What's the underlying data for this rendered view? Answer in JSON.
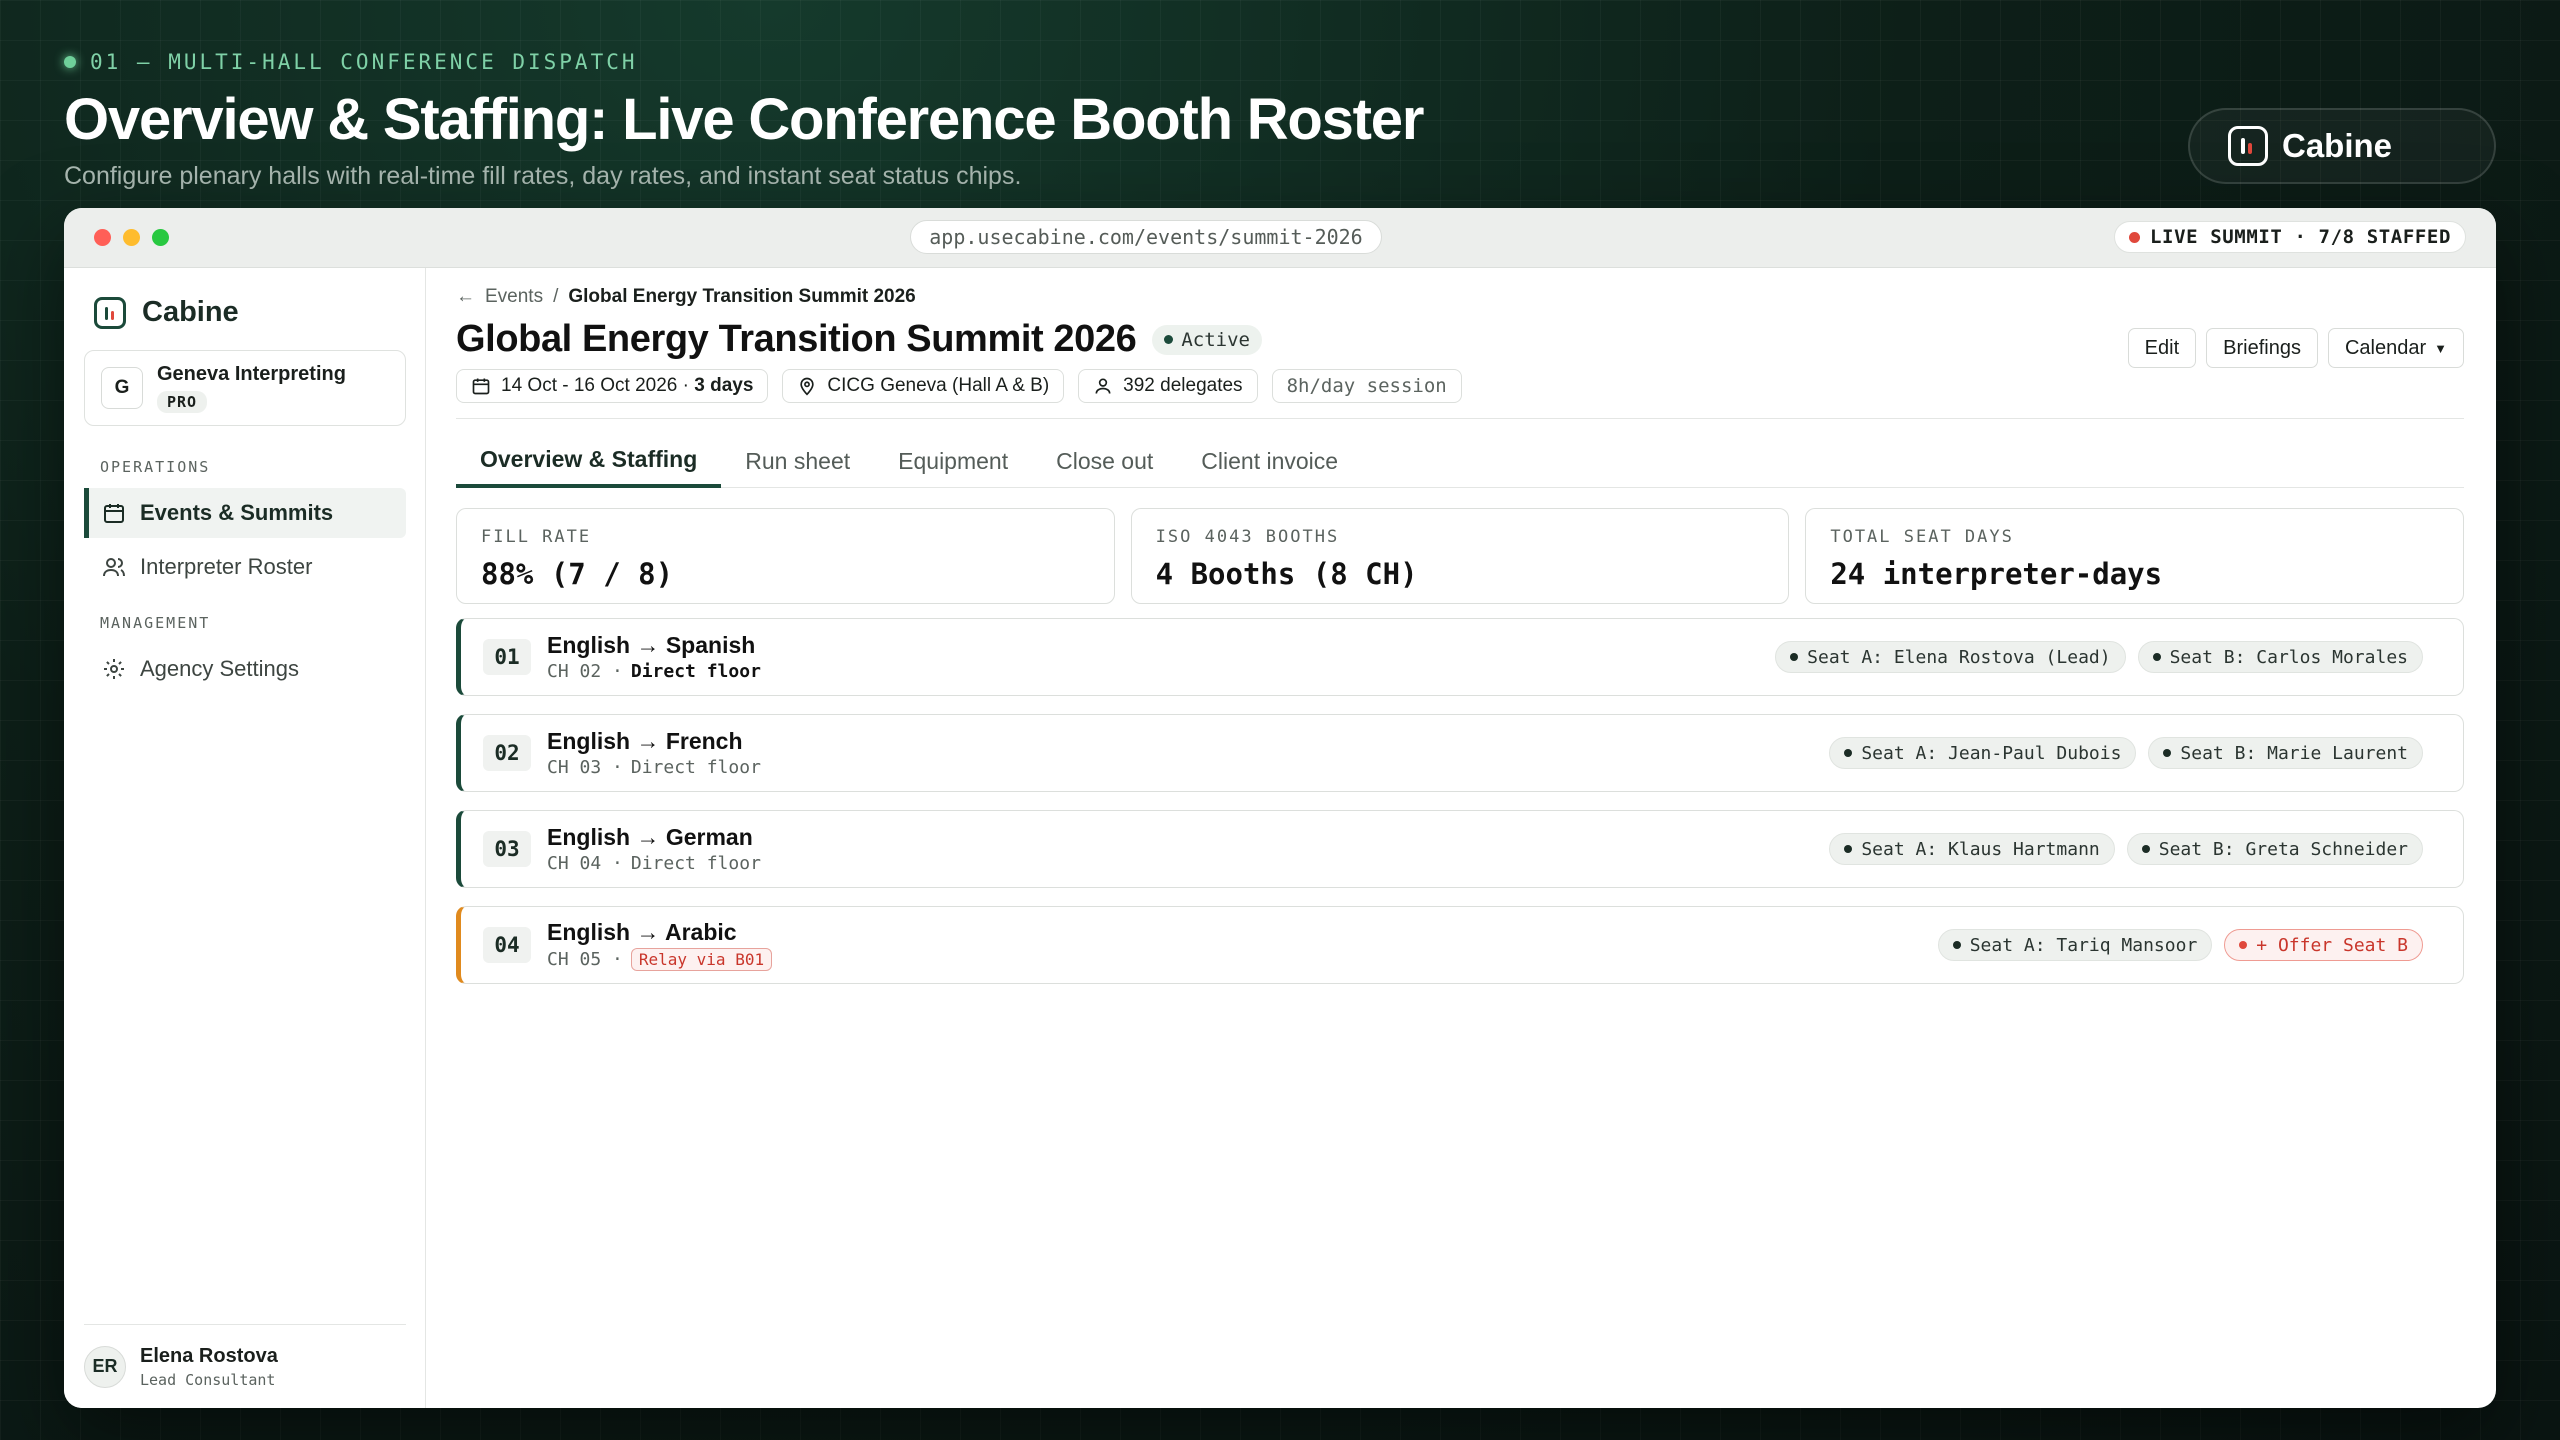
{
  "hero": {
    "kicker": "01 — MULTI-HALL CONFERENCE DISPATCH",
    "title": "Overview & Staffing: Live Conference Booth Roster",
    "subtitle": "Configure plenary halls with real-time fill rates, day rates, and instant seat status chips.",
    "brand": "Cabine"
  },
  "browser": {
    "url": "app.usecabine.com/events/summit-2026",
    "live_badge": "LIVE SUMMIT · 7/8 STAFFED"
  },
  "sidebar": {
    "brand": "Cabine",
    "org": {
      "initial": "G",
      "name": "Geneva Interpreting",
      "plan": "PRO"
    },
    "operations_label": "OPERATIONS",
    "operations": [
      {
        "label": "Events & Summits",
        "icon": "calendar-icon"
      },
      {
        "label": "Interpreter Roster",
        "icon": "users-icon"
      }
    ],
    "management_label": "MANAGEMENT",
    "management": [
      {
        "label": "Agency Settings",
        "icon": "gear-icon"
      }
    ],
    "user": {
      "initials": "ER",
      "name": "Elena Rostova",
      "role": "Lead Consultant"
    }
  },
  "main": {
    "breadcrumb": {
      "parent": "Events",
      "separator": "/",
      "current": "Global Energy Transition Summit 2026"
    },
    "title": "Global Energy Transition Summit 2026",
    "status": "Active",
    "meta": {
      "dates": "14 Oct - 16 Oct 2026 · ",
      "duration": "3 days",
      "venue": "CICG Geneva (Hall A & B)",
      "delegates": "392 delegates",
      "session": "8h/day session"
    },
    "actions": {
      "edit": "Edit",
      "briefings": "Briefings",
      "calendar": "Calendar"
    },
    "tabs": [
      "Overview & Staffing",
      "Run sheet",
      "Equipment",
      "Close out",
      "Client invoice"
    ],
    "stats": [
      {
        "label": "FILL RATE",
        "value": "88% (7 / 8)"
      },
      {
        "label": "ISO 4043 BOOTHS",
        "value": "4 Booths (8 CH)"
      },
      {
        "label": "TOTAL SEAT DAYS",
        "value": "24 interpreter-days"
      }
    ],
    "booths": [
      {
        "num": "01",
        "lang": "English → Spanish",
        "channel": "CH 02 ·",
        "floor": "Direct floor",
        "seat_a": "Seat A: Elena Rostova (Lead)",
        "seat_b": "Seat B: Carlos Morales"
      },
      {
        "num": "02",
        "lang": "English → French",
        "channel": "CH 03 ·",
        "floor": "Direct floor",
        "seat_a": "Seat A: Jean-Paul Dubois",
        "seat_b": "Seat B: Marie Laurent"
      },
      {
        "num": "03",
        "lang": "English → German",
        "channel": "CH 04 ·",
        "floor": "Direct floor",
        "seat_a": "Seat A: Klaus Hartmann",
        "seat_b": "Seat B: Greta Schneider"
      },
      {
        "num": "04",
        "lang": "English → Arabic",
        "channel": "CH 05 ·",
        "relay": "Relay via B01",
        "seat_a": "Seat A: Tariq Mansoor",
        "offer": "+ Offer Seat B"
      }
    ]
  },
  "colors": {
    "accent": "#1b4a3a",
    "warning": "#e08a1e",
    "danger": "#e0483c"
  }
}
